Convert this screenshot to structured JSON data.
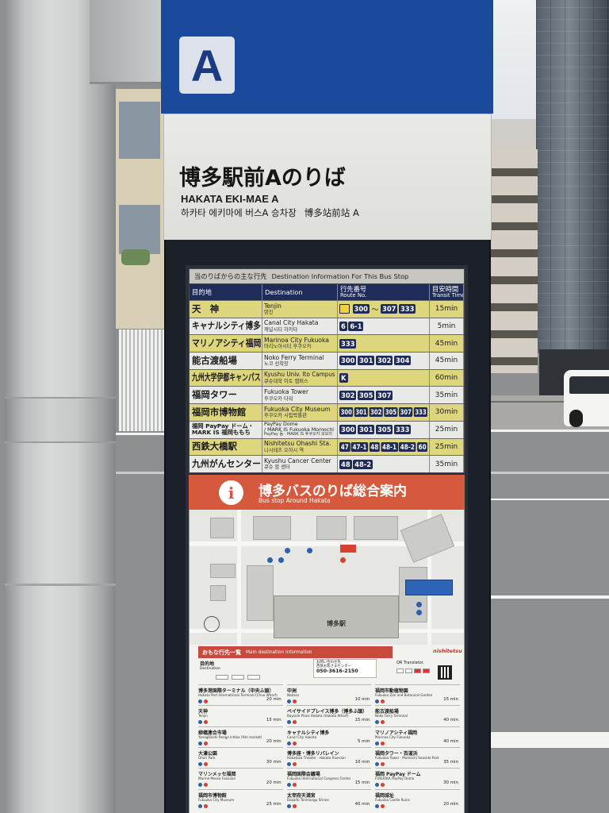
{
  "sign": {
    "platform_letter": "A",
    "title_ja": "博多駅前Aのりば",
    "title_en": "HAKATA EKI-MAE A",
    "title_ko": "하카타 에키마에 버스A 승차장",
    "title_zh": "博多站前站 A",
    "panel_color": "#1b4a9c"
  },
  "timetable": {
    "header_ja": "当のりばからの主な行先",
    "header_en": "Destination Information For This Bus Stop",
    "columns": {
      "destination_ja": "目的地",
      "destination_en": "Destination",
      "route_ja": "行先番号",
      "route_en": "Route No.",
      "time_ja": "目安時間",
      "time_en": "Transit Time"
    },
    "highlight_color": "#ddd67c",
    "badge_color": "#1f2b58",
    "rows": [
      {
        "ja": "天　神",
        "en": "Tenjin",
        "ko": "텐진",
        "express_icon": true,
        "routes": [
          "300",
          "〜",
          "307",
          "333"
        ],
        "time": "15min",
        "highlight": true
      },
      {
        "ja": "キャナルシティ博多",
        "en": "Canal City Hakata",
        "ko": "캐널시티 하카타",
        "routes": [
          "6",
          "6-1"
        ],
        "time": "5min",
        "highlight": false
      },
      {
        "ja": "マリノアシティ福岡",
        "en": "Marinoa City Fukuoka",
        "ko": "마리노아시티 후쿠오카",
        "routes": [
          "333"
        ],
        "time": "45min",
        "highlight": true
      },
      {
        "ja": "能古渡船場",
        "en": "Noko Ferry Terminal",
        "ko": "노코 선착장",
        "routes": [
          "300",
          "301",
          "302",
          "304"
        ],
        "time": "45min",
        "highlight": false
      },
      {
        "ja": "九州大学伊都キャンパス",
        "en": "Kyushu Univ. Ito Campus",
        "ko": "큐슈대학 이토 캠퍼스",
        "routes": [
          "K"
        ],
        "time": "60min",
        "highlight": true
      },
      {
        "ja": "福岡タワー",
        "en": "Fukuoka Tower",
        "ko": "후쿠오카 타워",
        "routes": [
          "302",
          "305",
          "307"
        ],
        "time": "35min",
        "highlight": false
      },
      {
        "ja": "福岡市博物館",
        "en": "Fukuoka City Museum",
        "ko": "후쿠오카 시립박물관",
        "routes": [
          "300",
          "301",
          "302",
          "305",
          "307",
          "333"
        ],
        "time": "30min",
        "highlight": true
      },
      {
        "ja": "福岡 PayPay ドーム・",
        "ja2": "MARK IS 福岡ももち",
        "en": "PayPay Dome",
        "en2": "/ MARK IS Fukuoka Momochi",
        "ko": "PayPay 돔 · MARK IS 후쿠오카 모모치",
        "routes": [
          "300",
          "301",
          "305",
          "333"
        ],
        "time": "25min",
        "highlight": false
      },
      {
        "ja": "西鉄大橋駅",
        "en": "Nishitetsu Ohashi Sta.",
        "ko": "니시테츠 오하시 역",
        "routes": [
          "47",
          "47-1",
          "48",
          "48-1",
          "48-2",
          "60"
        ],
        "time": "25min",
        "highlight": true
      },
      {
        "ja": "九州がんセンター",
        "en": "Kyushu Cancer Center",
        "ko": "큐슈 암 센터",
        "routes": [
          "48",
          "48-2"
        ],
        "time": "35min",
        "highlight": false
      }
    ]
  },
  "guide": {
    "icon": "info-icon",
    "icon_glyph": "i",
    "title": "博多バスのりば総合案内",
    "subtitle": "Bus stop Around Hakata",
    "color": "#d55a3d"
  },
  "map": {
    "station_label": "博多駅"
  },
  "destinations": {
    "header_ja": "おもな行先一覧",
    "header_en": "Main destination information",
    "logo": "nishitetsu",
    "list_label_ja": "目的地",
    "list_label_en": "Destination",
    "contact": {
      "label": "お問い合わせ先",
      "center": "西鉄お客さまセンター",
      "phone": "050-3616-2150"
    },
    "qr_label": "QR Translator.",
    "entries": [
      {
        "ja": "博多港国際ターミナル（中央ふ頭）",
        "en": "Hakata Port International Terminal (Chuo Wharf)",
        "time": "20 min"
      },
      {
        "ja": "中洲",
        "en": "Nakasu",
        "time": "10 min"
      },
      {
        "ja": "福岡市動植物園",
        "en": "Fukuoka Zoo and Botanical Garden",
        "time": "15 min"
      },
      {
        "ja": "天神",
        "en": "Tenjin",
        "time": "15 min"
      },
      {
        "ja": "ベイサイドプレイス博多（博多ふ頭）",
        "en": "Bayside Place Hakata (Hakata Wharf)",
        "time": "15 min"
      },
      {
        "ja": "能古渡船場",
        "en": "Noko Ferry Terminal",
        "time": "40 min"
      },
      {
        "ja": "柳橋連合市場",
        "en": "Yanagibashi Rengo Ichiba (fish market)",
        "time": "20 min"
      },
      {
        "ja": "キャナルシティ博多",
        "en": "Canal City Hakata",
        "time": "5 min"
      },
      {
        "ja": "マリノアシティ福岡",
        "en": "Marinoa City Fukuoka",
        "time": "40 min"
      },
      {
        "ja": "大濠公園",
        "en": "Ohori Park",
        "time": "30 min"
      },
      {
        "ja": "博多座・博多リバレイン",
        "en": "Hakataza Theater · Hakata Riverain",
        "time": "10 min"
      },
      {
        "ja": "福岡タワー・百道浜",
        "en": "Fukuoka Tower · Momochi Seaside Park",
        "time": "35 min"
      },
      {
        "ja": "マリンメッセ福岡",
        "en": "Marine Messe Fukuoka",
        "time": "20 min"
      },
      {
        "ja": "福岡国際会議場",
        "en": "Fukuoka International Congress Center",
        "time": "15 min"
      },
      {
        "ja": "福岡 PayPay ドーム",
        "en": "FUKUOKA PayPay Dome",
        "time": "30 min"
      },
      {
        "ja": "福岡市博物館",
        "en": "Fukuoka City Museum",
        "time": "25 min"
      },
      {
        "ja": "太宰府天満宮",
        "en": "Dazaifu Tenmangu Shrine",
        "time": "40 min"
      },
      {
        "ja": "福岡城址",
        "en": "Fukuoka Castle Ruins",
        "time": "20 min"
      }
    ]
  }
}
